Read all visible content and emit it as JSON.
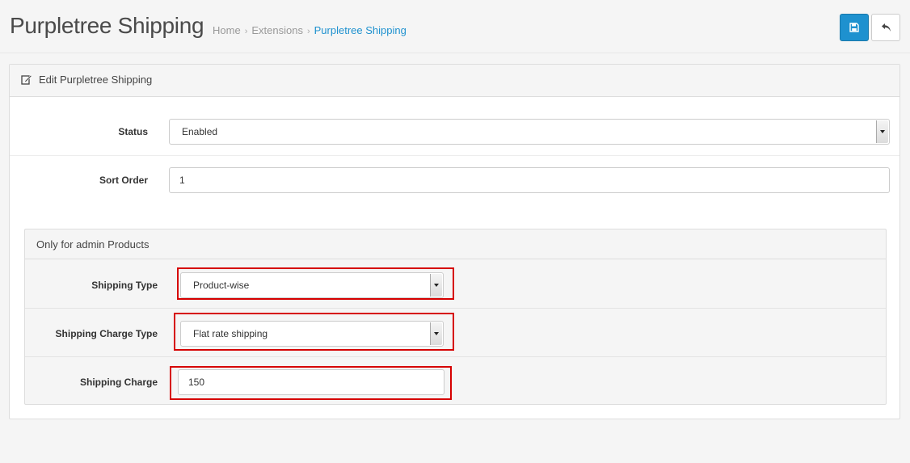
{
  "header": {
    "title": "Purpletree Shipping",
    "breadcrumb": [
      {
        "label": "Home"
      },
      {
        "label": "Extensions"
      },
      {
        "label": "Purpletree Shipping"
      }
    ],
    "separator": "›"
  },
  "toolbar": {
    "save_icon": "floppy-disk-icon",
    "back_icon": "reply-arrow-icon"
  },
  "panel": {
    "title": "Edit Purpletree Shipping",
    "icon": "pencil-square-icon"
  },
  "form": {
    "status": {
      "label": "Status",
      "value": "Enabled"
    },
    "sort_order": {
      "label": "Sort Order",
      "value": "1"
    }
  },
  "admin_products": {
    "title": "Only for admin Products",
    "shipping_type": {
      "label": "Shipping Type",
      "value": "Product-wise"
    },
    "shipping_charge_type": {
      "label": "Shipping Charge Type",
      "value": "Flat rate shipping"
    },
    "shipping_charge": {
      "label": "Shipping Charge",
      "value": "150"
    }
  },
  "colors": {
    "primary": "#1e91cf",
    "highlight": "#d60000",
    "link": "#1e91cf"
  }
}
